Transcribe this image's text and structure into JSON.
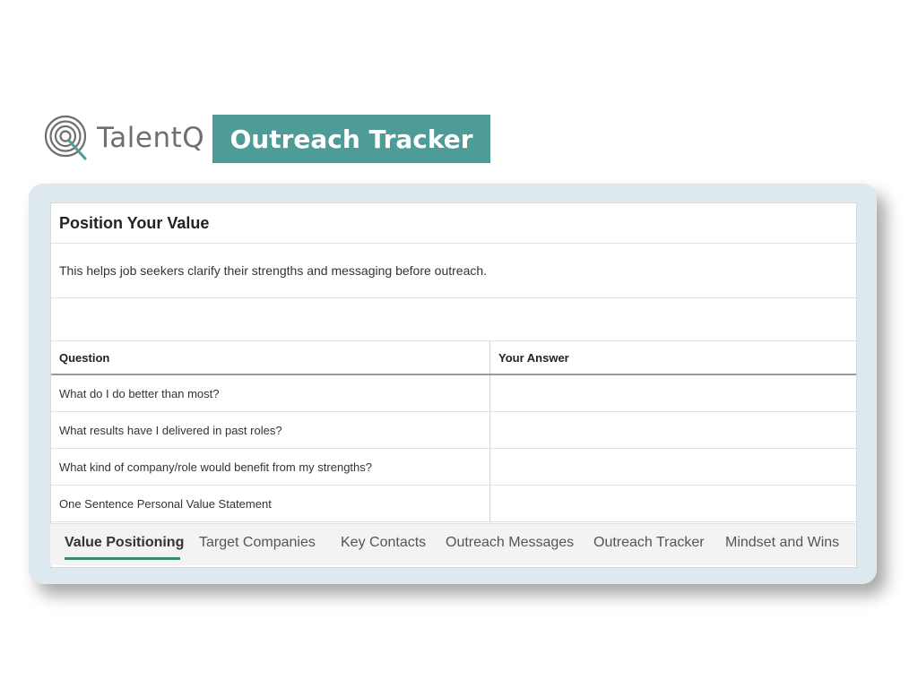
{
  "brand": {
    "name": "TalentQ",
    "banner": "Outreach Tracker",
    "banner_color": "#4e9c98"
  },
  "sheet": {
    "title": "Position Your Value",
    "description": "This helps job seekers clarify their strengths and messaging before outreach.",
    "columns": [
      "Question",
      "Your Answer"
    ],
    "rows": [
      {
        "question": "What do I do better than most?",
        "answer": ""
      },
      {
        "question": "What results have I delivered in past roles?",
        "answer": ""
      },
      {
        "question": "What kind of company/role would benefit from my strengths?",
        "answer": ""
      },
      {
        "question": "One Sentence Personal Value Statement",
        "answer": ""
      }
    ]
  },
  "tabs": [
    "Value Positioning",
    "Target Companies",
    "Key Contacts",
    "Outreach Messages",
    "Outreach Tracker",
    "Mindset and Wins"
  ],
  "active_tab": "Value Positioning",
  "accent_color": "#3b8a66"
}
